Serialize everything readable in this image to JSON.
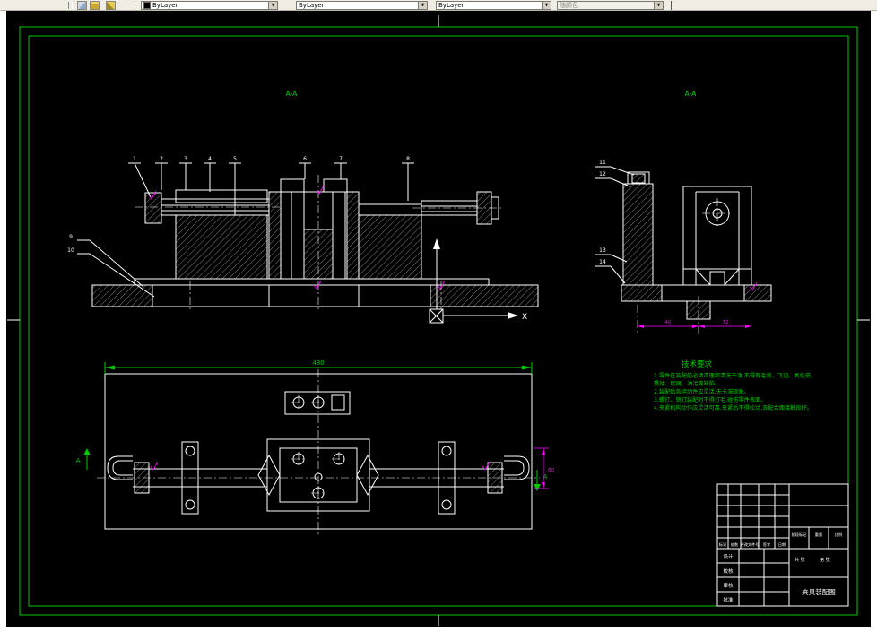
{
  "toolbar": {
    "color_value": "ByLayer",
    "linetype_value": "ByLayer",
    "lineweight_value": "ByLayer",
    "plotstyle_value": "随颜色"
  },
  "drawing": {
    "section_label_front": "A-A",
    "section_label_side": "A-A",
    "ucs_x_label": "X",
    "balloons": {
      "front": [
        "1",
        "2",
        "3",
        "4",
        "5",
        "6",
        "7",
        "8"
      ],
      "left": [
        "9",
        "10"
      ],
      "side": [
        "11",
        "12",
        "13",
        "14"
      ]
    },
    "dims": {
      "plan_width": "480",
      "side_dim1": "40",
      "side_dim2": "72",
      "plan_right": "60",
      "section_arrow": "A"
    },
    "tech": {
      "title": "技术要求",
      "lines": [
        "1.零件在装配前必须清理和清洗干净,不得有毛刺、飞边、氧化皮、",
        "  锈蚀、切屑、油污等缺陷。",
        "2.装配后各运动件应灵活,无卡滞现象。",
        "3.螺钉、销钉装配时不得打毛,碰伤零件表面。",
        "4.夹紧机构动作应灵活可靠,夹紧后不得松动,各配合面接触良好。"
      ]
    },
    "title_block": {
      "rev_headers": [
        "标记",
        "处数",
        "更改文件号",
        "签字",
        "日期"
      ],
      "sign_rows": [
        "设计",
        "校核",
        "审核",
        "批准"
      ],
      "stage_label": "阶段标记",
      "weight_label": "重量",
      "scale_label": "比例",
      "sheets": "共 张",
      "sheet_no": "第 张",
      "name": "夹具装配图"
    }
  }
}
